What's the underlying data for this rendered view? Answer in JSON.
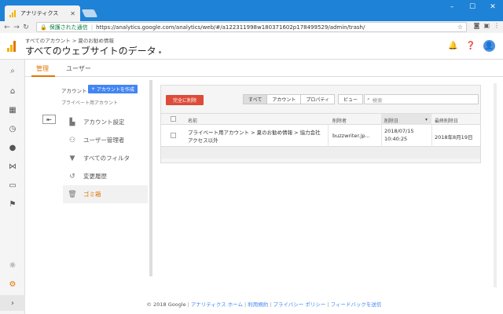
{
  "browser": {
    "tab_title": "アナリティクス",
    "secure_label": "保護された通信",
    "url": "https://analytics.google.com/analytics/web/#/a122311998w180371602p178499529/admin/trash/"
  },
  "header": {
    "breadcrumb": "すべてのアカウント > 夏のお勧め情報",
    "title": "すべてのウェブサイトのデータ"
  },
  "tabs": [
    {
      "label": "管理"
    },
    {
      "label": "ユーザー"
    }
  ],
  "account": {
    "label": "アカウント",
    "create_button": "アカウントを作成",
    "property_label": "プライベート用アカウント"
  },
  "menu": [
    {
      "label": "アカウント設定",
      "icon": "building-icon"
    },
    {
      "label": "ユーザー管理者",
      "icon": "users-icon"
    },
    {
      "label": "すべてのフィルタ",
      "icon": "filter-icon"
    },
    {
      "label": "変更履歴",
      "icon": "history-icon"
    },
    {
      "label": "ゴミ箱",
      "icon": "trash-icon"
    }
  ],
  "trash": {
    "delete_button": "完全に削除",
    "filters": [
      "すべて",
      "アカウント",
      "プロパティ",
      "ビュー"
    ],
    "search_placeholder": "検索",
    "columns": {
      "name": "名前",
      "deleted_by": "削除者",
      "deleted_date": "削除日",
      "final_delete_date": "最終削除日"
    },
    "rows": [
      {
        "name_line1": "プライベート用アカウント > 夏のお勧め情報 > 協力会社",
        "name_line2": "アクセス以外",
        "deleted_by": "buzzwriter.jp...",
        "deleted_date_line1": "2018/07/15",
        "deleted_date_line2": "10:40:25",
        "final_delete_date": "2018年8月19日"
      }
    ]
  },
  "footer": {
    "copyright": "© 2018 Google",
    "links": [
      "アナリティクス ホーム",
      "利用規約",
      "プライバシー ポリシー",
      "フィードバックを送信"
    ]
  },
  "colors": {
    "accent": "#e37400",
    "primary_button": "#4285f4",
    "danger": "#dd4b39",
    "chrome_blue": "#1e82d6"
  }
}
